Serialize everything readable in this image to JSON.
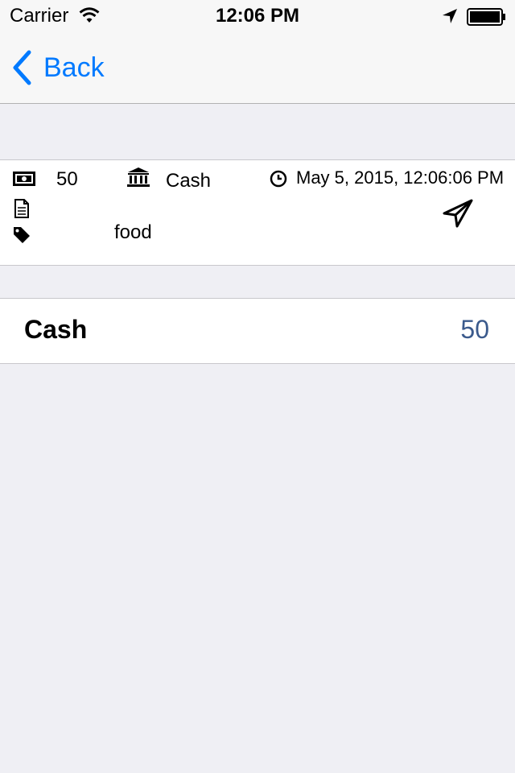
{
  "status_bar": {
    "carrier": "Carrier",
    "time": "12:06 PM"
  },
  "nav": {
    "back_label": "Back"
  },
  "transaction": {
    "amount": "50",
    "account": "Cash",
    "datetime": "May 5, 2015, 12:06:06 PM",
    "note": "",
    "tag": "food",
    "icons": {
      "amount": "money-icon",
      "account": "bank-icon",
      "datetime": "clock-icon",
      "note": "document-icon",
      "tag": "tag-icon",
      "send": "paper-plane-icon"
    }
  },
  "account_summary": {
    "name": "Cash",
    "amount": "50"
  },
  "colors": {
    "accent": "#007aff",
    "amount_value": "#3b5a8c",
    "background": "#efeff4"
  }
}
